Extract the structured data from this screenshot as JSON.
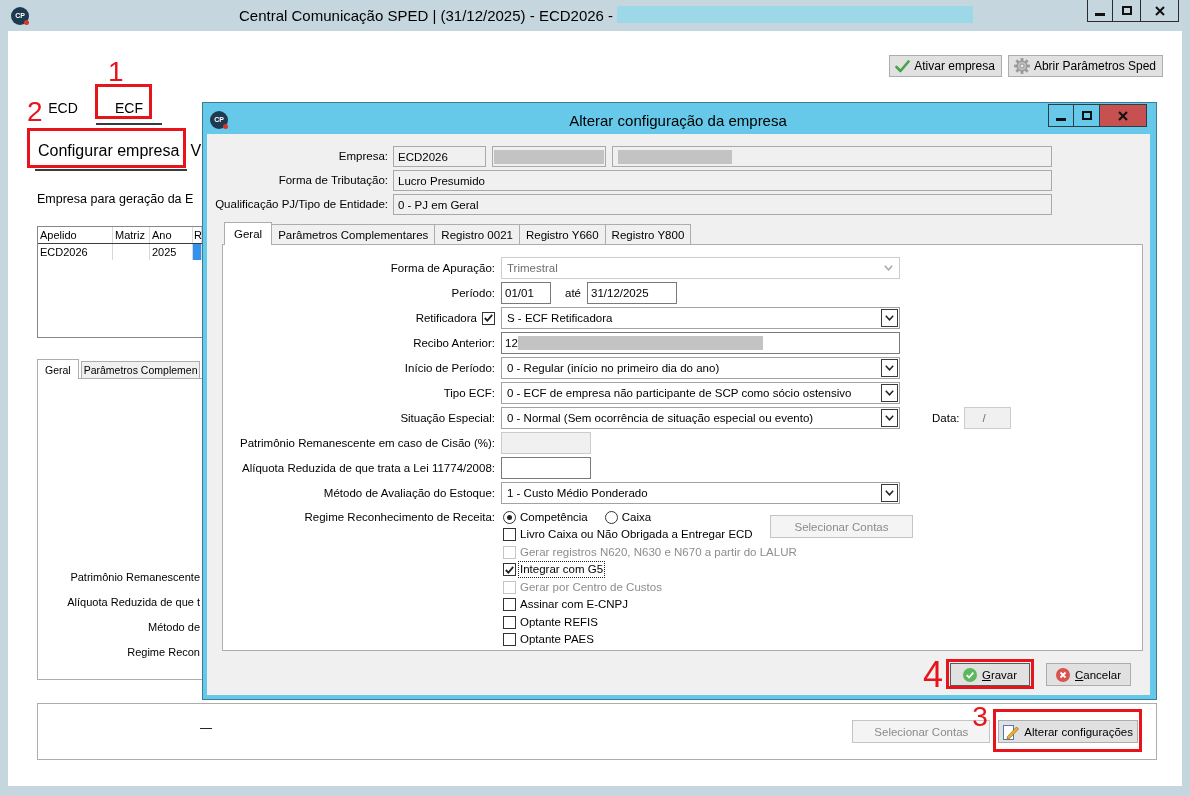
{
  "window": {
    "logo": "CP",
    "title": "Central Comunicação SPED | (31/12/2025) - ECD2026 -",
    "title_redacted": true
  },
  "toolbar": {
    "activate_button": "Ativar empresa",
    "parameters_button": "Abrir Parâmetros Sped"
  },
  "tabs": [
    {
      "label": "ECD",
      "selected": false
    },
    {
      "label": "ECF",
      "selected": true,
      "callout": "1"
    }
  ],
  "subtabs": [
    {
      "label": "Configurar empresa",
      "selected": true,
      "callout": "2"
    },
    {
      "label": "V",
      "selected": false
    }
  ],
  "company_list": {
    "caption": "Empresa para geração da E",
    "columns": [
      "Apelido",
      "Matriz",
      "Ano",
      "R"
    ],
    "rows": [
      {
        "cells": [
          {
            "text": "ECD2026",
            "selected": false
          },
          {
            "selected": false
          },
          {
            "text": "2025",
            "selected": false
          },
          {
            "selected": true
          }
        ]
      }
    ]
  },
  "details": {
    "tabs": [
      {
        "label": "Geral",
        "selected": true
      },
      {
        "label": "Parâmetros Complemen",
        "selected": false
      }
    ],
    "labels": [
      "Patrimônio Remanescente",
      "Alíquota Reduzida de que t",
      "Método de",
      "Regime Recon"
    ]
  },
  "footer": {
    "label": "—",
    "select_button": {
      "label": "Selecionar Contas",
      "disabled": true
    },
    "change_button": {
      "label": "Alterar configurações",
      "disabled": false,
      "callout": "3"
    }
  },
  "dialog": {
    "logo": "CP",
    "title": "Alterar configuração da empresa",
    "company": {
      "label": "Empresa:",
      "fields": [
        {
          "value": "ECD2026",
          "redacted": false
        },
        {
          "redacted": true
        },
        {
          "redacted": true
        }
      ]
    },
    "header_fields": [
      {
        "label": "Forma de Tributação:",
        "value": "Lucro Presumido"
      },
      {
        "label": "Qualificação PJ/Tipo de Entidade:",
        "value": "0 - PJ em Geral"
      }
    ],
    "tabs": [
      {
        "label": "Geral",
        "selected": true
      },
      {
        "label": "Parâmetros Complementares",
        "selected": false
      },
      {
        "label": "Registro 0021",
        "selected": false
      },
      {
        "label": "Registro Y660",
        "selected": false
      },
      {
        "label": "Registro Y800",
        "selected": false
      }
    ],
    "form": [
      {
        "kind": "select",
        "label": "Forma de Apuração:",
        "value": "Trimestral",
        "disabled": true
      },
      {
        "kind": "range",
        "label": "Período:",
        "from": "01/01",
        "separator": "até",
        "to": "31/12/2025"
      },
      {
        "kind": "check_select",
        "label": "Retificadora",
        "checked": true,
        "value": "S - ECF Retificadora"
      },
      {
        "kind": "text",
        "label": "Recibo Anterior:",
        "value": "12",
        "redacted": true
      },
      {
        "kind": "select",
        "label": "Início de Período:",
        "value": "0 - Regular (início no primeiro dia do ano)",
        "disabled": false
      },
      {
        "kind": "select",
        "label": "Tipo ECF:",
        "value": "0 - ECF de empresa não participante de SCP como sócio ostensivo",
        "disabled": false
      },
      {
        "kind": "select",
        "label": "Situação Especial:",
        "value": "0 - Normal (Sem ocorrência de situação especial ou evento)",
        "disabled": false,
        "date": {
          "label": "Data:",
          "value": "/",
          "disabled": true
        }
      },
      {
        "kind": "short",
        "label": "Patrimônio Remanescente em caso de Cisão (%):",
        "disabled": true
      },
      {
        "kind": "short",
        "label": "Alíquota Reduzida de que trata a Lei 11774/2008:",
        "disabled": false
      },
      {
        "kind": "select",
        "label": "Método de Avaliação do Estoque:",
        "value": "1 - Custo Médio Ponderado",
        "disabled": false
      }
    ],
    "revenue": {
      "label": "Regime Reconhecimento de Receita:",
      "options": [
        {
          "label": "Competência",
          "selected": true
        },
        {
          "label": "Caixa",
          "selected": false
        }
      ],
      "accounts_button": {
        "label": "Selecionar Contas",
        "disabled": true
      }
    },
    "options": [
      {
        "label": "Livro Caixa ou Não Obrigada a Entregar ECD",
        "checked": false,
        "disabled": false,
        "focused": false
      },
      {
        "label": "Gerar registros N620, N630 e N670 a partir do LALUR",
        "checked": false,
        "disabled": true,
        "focused": false
      },
      {
        "label": "Integrar com G5",
        "checked": true,
        "disabled": false,
        "focused": true
      },
      {
        "label": "Gerar por Centro de Custos",
        "checked": false,
        "disabled": true,
        "focused": false
      },
      {
        "label": "Assinar com E-CNPJ",
        "checked": false,
        "disabled": false,
        "focused": false
      },
      {
        "label": "Optante REFIS",
        "checked": false,
        "disabled": false,
        "focused": false
      },
      {
        "label": "Optante PAES",
        "checked": false,
        "disabled": false,
        "focused": false
      }
    ],
    "save_button": {
      "label": "Gravar",
      "callout": "4"
    },
    "cancel_button": {
      "label": "Cancelar"
    }
  }
}
